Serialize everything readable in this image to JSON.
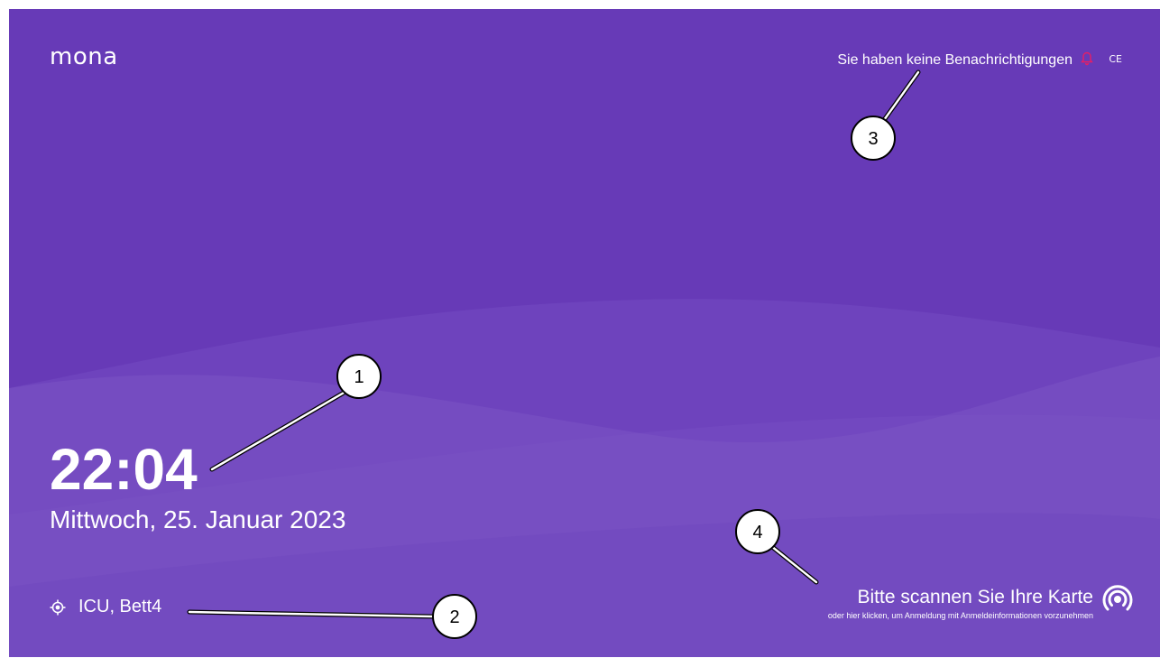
{
  "app": {
    "logo": "mona"
  },
  "header": {
    "notification_text": "Sie haben keine Benachrichtigungen",
    "ce_mark": "CE"
  },
  "clock": {
    "time": "22:04",
    "date": "Mittwoch, 25. Januar 2023"
  },
  "location": {
    "label": "ICU, Bett4"
  },
  "login": {
    "title": "Bitte scannen Sie Ihre Karte",
    "subtitle": "oder hier klicken, um Anmeldung mit Anmeldeinformationen vorzunehmen"
  },
  "callouts": [
    {
      "number": "1"
    },
    {
      "number": "2"
    },
    {
      "number": "3"
    },
    {
      "number": "4"
    }
  ],
  "colors": {
    "background": "#673ab7",
    "bell": "#e91e63",
    "text": "#ffffff"
  },
  "icons": {
    "notification": "bell-icon",
    "location": "location-target-icon",
    "card": "nfc-contactless-icon"
  }
}
